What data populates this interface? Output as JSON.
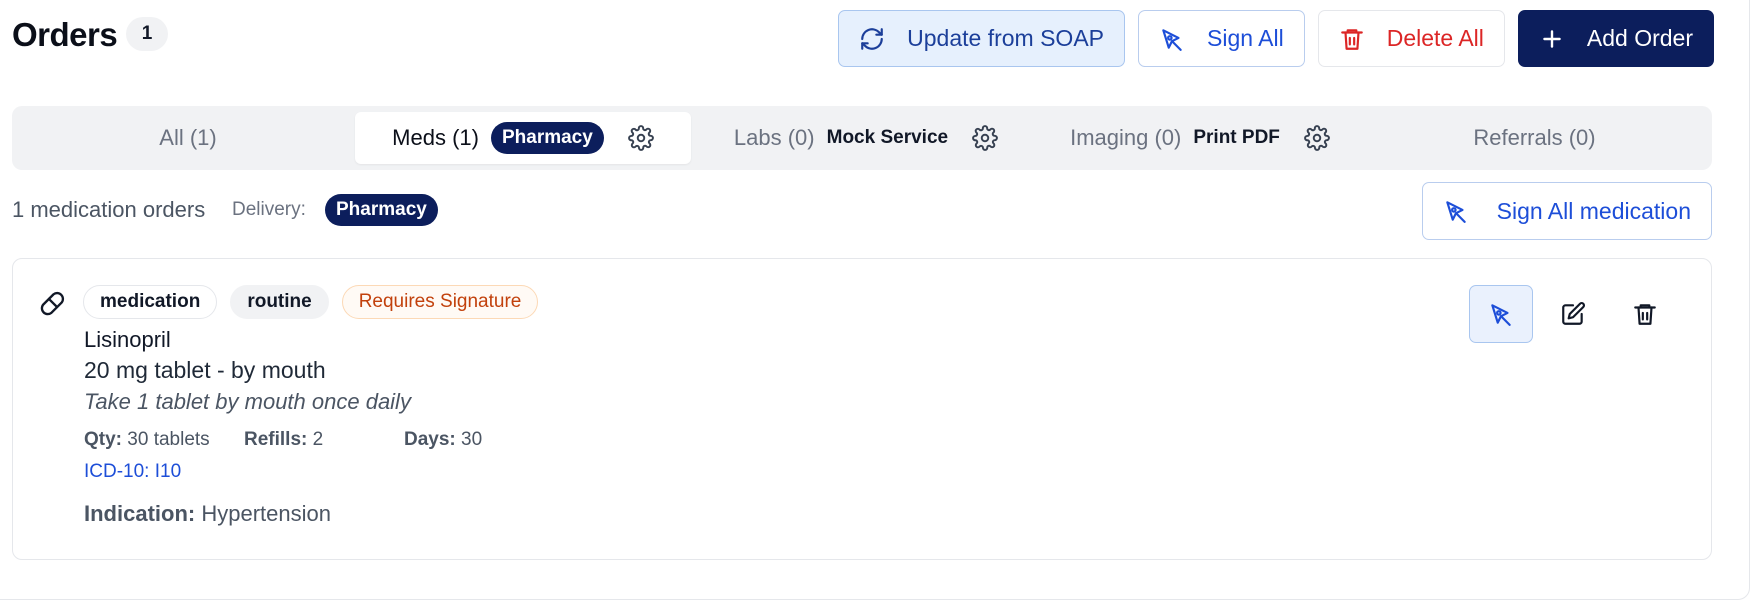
{
  "header": {
    "title": "Orders",
    "count": "1",
    "actions": {
      "update_soap": "Update from SOAP",
      "sign_all": "Sign All",
      "delete_all": "Delete All",
      "add_order": "Add Order"
    }
  },
  "tabs": [
    {
      "label": "All (1)"
    },
    {
      "label": "Meds (1)",
      "badge": "Pharmacy",
      "active": true
    },
    {
      "label": "Labs (0)",
      "service": "Mock Service"
    },
    {
      "label": "Imaging (0)",
      "service": "Print PDF"
    },
    {
      "label": "Referrals (0)"
    }
  ],
  "subheader": {
    "count_text": "1 medication orders",
    "delivery_label": "Delivery:",
    "delivery_value": "Pharmacy",
    "sign_all_medication": "Sign All medication"
  },
  "order": {
    "chips": [
      "medication",
      "routine",
      "Requires Signature"
    ],
    "name": "Lisinopril",
    "dose": "20 mg tablet - by mouth",
    "sig": "Take 1 tablet by mouth once daily",
    "qty_label": "Qty:",
    "qty_value": "30 tablets",
    "refills_label": "Refills:",
    "refills_value": "2",
    "days_label": "Days:",
    "days_value": "30",
    "icd": "ICD-10: I10",
    "indication_label": "Indication:",
    "indication_value": "Hypertension"
  },
  "colors": {
    "primary_dark": "#0c1e5c",
    "link_blue": "#1d4ed8",
    "danger": "#dc2626",
    "warning": "#c2410c"
  },
  "icons": {
    "update": "refresh-icon",
    "sign": "pen-nib-icon",
    "delete": "trash-icon",
    "add": "plus-icon",
    "settings": "gear-icon",
    "medication": "pill-icon",
    "edit": "edit-icon"
  }
}
